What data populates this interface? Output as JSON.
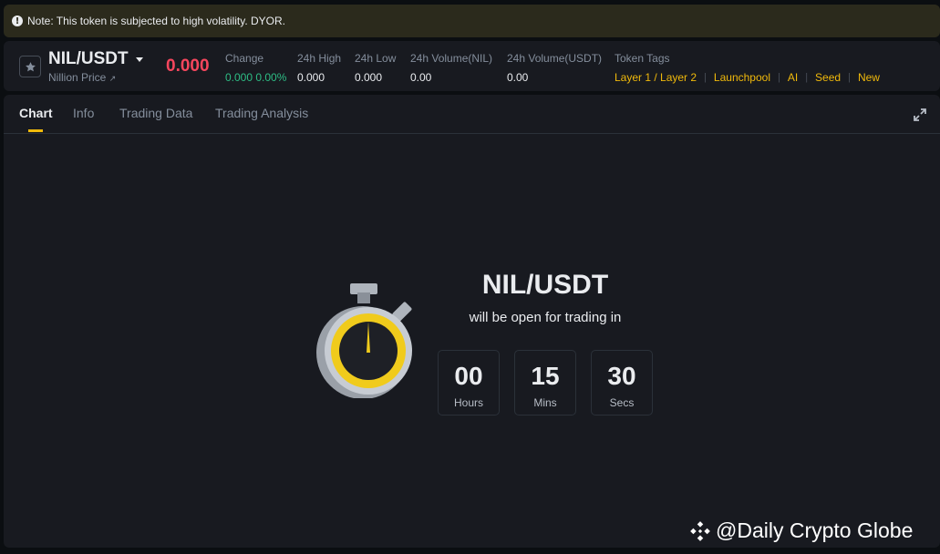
{
  "note": {
    "text": "Note: This token is subjected to high volatility. DYOR."
  },
  "header": {
    "pair": "NIL/USDT",
    "subname": "Nillion Price",
    "price": "0.000",
    "stats": [
      {
        "label": "Change",
        "value": "0.000 0.00%"
      },
      {
        "label": "24h High",
        "value": "0.000"
      },
      {
        "label": "24h Low",
        "value": "0.000"
      },
      {
        "label": "24h Volume(NIL)",
        "value": "0.00"
      },
      {
        "label": "24h Volume(USDT)",
        "value": "0.00"
      }
    ],
    "tags_label": "Token Tags",
    "tags": [
      "Layer 1 / Layer 2",
      "Launchpool",
      "AI",
      "Seed",
      "New"
    ]
  },
  "tabs": [
    "Chart",
    "Info",
    "Trading Data",
    "Trading Analysis"
  ],
  "countdown": {
    "title": "NIL/USDT",
    "subtitle": "will be open for trading in",
    "units": [
      {
        "value": "00",
        "label": "Hours"
      },
      {
        "value": "15",
        "label": "Mins"
      },
      {
        "value": "30",
        "label": "Secs"
      }
    ]
  },
  "watermark": "@Daily Crypto Globe",
  "colors": {
    "accent": "#f0b90b",
    "down": "#f6465d",
    "up": "#2ebd85",
    "bg": "#181a20"
  }
}
